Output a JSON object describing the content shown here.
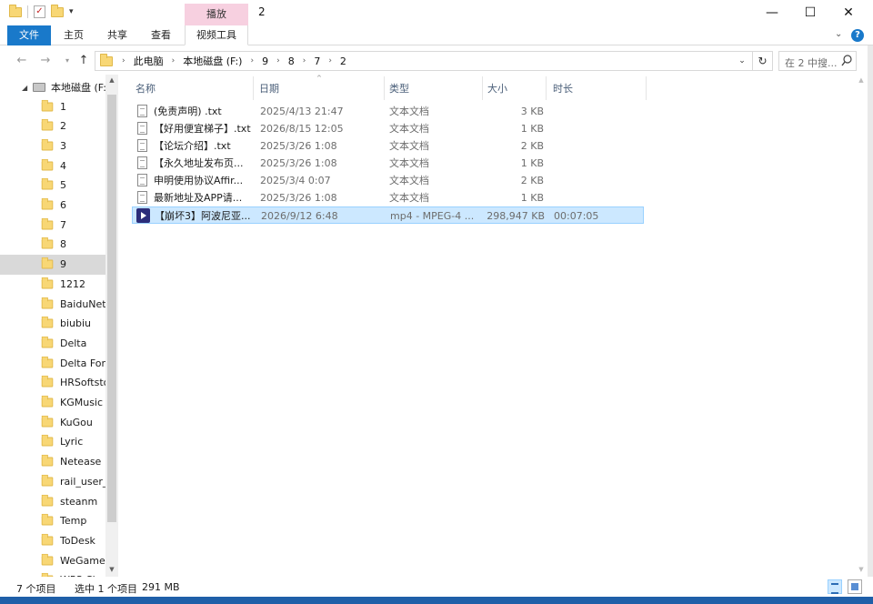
{
  "titlebar": {
    "title": "2",
    "context_tab_header": "播放",
    "controls": {
      "minimize": "—",
      "maximize": "☐",
      "close": "✕"
    }
  },
  "ribbon": {
    "tabs": [
      "文件",
      "主页",
      "共享",
      "查看",
      "视频工具"
    ]
  },
  "address": {
    "crumbs": [
      "此电脑",
      "本地磁盘 (F:)",
      "9",
      "8",
      "7",
      "2"
    ],
    "search_placeholder": "在 2 中搜..."
  },
  "navpane": {
    "drive_label": "本地磁盘 (F:)",
    "folders": [
      "1",
      "2",
      "3",
      "4",
      "5",
      "6",
      "7",
      "8",
      "9",
      "1212",
      "BaiduNetd",
      "biubiu",
      "Delta",
      "Delta Forc",
      "HRSoftsto",
      "KGMusic",
      "KuGou",
      "Lyric",
      "Netease",
      "rail_user_d",
      "steanm",
      "Temp",
      "ToDesk",
      "WeGameA",
      "WPS Cl..."
    ],
    "selected_index": 8
  },
  "columns": {
    "name": "名称",
    "date": "日期",
    "type": "类型",
    "size": "大小",
    "duration": "时长"
  },
  "files": [
    {
      "name": "(免责声明) .txt",
      "date": "2025/4/13 21:47",
      "type": "文本文档",
      "size": "3 KB",
      "duration": "",
      "icon": "text-file-icon",
      "selected": false
    },
    {
      "name": "【好用便宜梯子】.txt",
      "date": "2026/8/15 12:05",
      "type": "文本文档",
      "size": "1 KB",
      "duration": "",
      "icon": "text-file-icon",
      "selected": false
    },
    {
      "name": "【论坛介绍】.txt",
      "date": "2025/3/26 1:08",
      "type": "文本文档",
      "size": "2 KB",
      "duration": "",
      "icon": "text-file-icon",
      "selected": false
    },
    {
      "name": "【永久地址发布页...",
      "date": "2025/3/26 1:08",
      "type": "文本文档",
      "size": "1 KB",
      "duration": "",
      "icon": "text-file-icon",
      "selected": false
    },
    {
      "name": "申明使用协议Affir...",
      "date": "2025/3/4 0:07",
      "type": "文本文档",
      "size": "2 KB",
      "duration": "",
      "icon": "text-file-icon",
      "selected": false
    },
    {
      "name": "最新地址及APP请...",
      "date": "2025/3/26 1:08",
      "type": "文本文档",
      "size": "1 KB",
      "duration": "",
      "icon": "text-file-icon",
      "selected": false
    },
    {
      "name": "【崩坏3】阿波尼亚...",
      "date": "2026/9/12 6:48",
      "type": "mp4 - MPEG-4 ...",
      "size": "298,947 KB",
      "duration": "00:07:05",
      "icon": "video-file-icon",
      "selected": true
    }
  ],
  "status": {
    "item_count": "7 个项目",
    "selected": "选中 1 个项目",
    "selected_size": "291 MB"
  },
  "colors": {
    "accent": "#1979ca",
    "context_tab": "#f7d0e0",
    "selection": "#cce8ff",
    "folder": "#f8d775"
  }
}
